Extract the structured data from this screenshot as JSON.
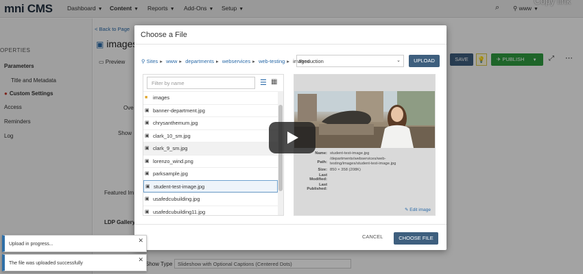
{
  "app": {
    "logo": "mni CMS",
    "copy_link": "Copy link"
  },
  "nav": {
    "items": [
      {
        "label": "Dashboard",
        "active": false
      },
      {
        "label": "Content",
        "active": true
      },
      {
        "label": "Reports",
        "active": false
      },
      {
        "label": "Add-Ons",
        "active": false
      },
      {
        "label": "Setup",
        "active": false
      }
    ],
    "site": "www"
  },
  "sidebar": {
    "heading": "OPERTIES",
    "items": [
      "Parameters",
      "Title and Metadata",
      "Custom Settings",
      "Access",
      "Reminders",
      "Log"
    ]
  },
  "page": {
    "back_link": "< Back to Page",
    "title": "images",
    "preview_tab": "Preview",
    "save": "SAVE",
    "publish": "PUBLISH",
    "labels": [
      "Ove",
      "Show",
      "Featured Im",
      "LDP Gallery",
      "Show Type"
    ],
    "select_value": "Slideshow with Optional Captions (Centered Dots)"
  },
  "modal": {
    "title": "Choose a File",
    "breadcrumb": [
      "Sites",
      "www",
      "departments",
      "webservices",
      "web-testing",
      "images"
    ],
    "environment": "Production",
    "upload": "UPLOAD",
    "filter_placeholder": "Filter by name",
    "files": [
      {
        "name": "images",
        "type": "folder"
      },
      {
        "name": "banner-department.jpg",
        "type": "file"
      },
      {
        "name": "chrysanthemum.jpg",
        "type": "file"
      },
      {
        "name": "clark_10_sm.jpg",
        "type": "file"
      },
      {
        "name": "clark_9_sm.jpg",
        "type": "file",
        "hover": true
      },
      {
        "name": "lorenzo_wind.png",
        "type": "file"
      },
      {
        "name": "parksample.jpg",
        "type": "file"
      },
      {
        "name": "student-test-image.jpg",
        "type": "file",
        "selected": true
      },
      {
        "name": "usafedcubuilding.jpg",
        "type": "file"
      },
      {
        "name": "usafedcubuilding11.jpg",
        "type": "file"
      }
    ],
    "details": {
      "name_label": "Name:",
      "name": "student-test-image.jpg",
      "path_label": "Path:",
      "path": "/departments/webservices/web-testing/images/student-test-image.jpg",
      "size_label": "Size:",
      "size": "850 × 358 (208K)",
      "modified_label": "Last Modified:",
      "modified": "",
      "published_label": "Last Published:",
      "published": ""
    },
    "edit_image": "Edit image",
    "cancel": "CANCEL",
    "choose": "CHOOSE FILE"
  },
  "toasts": [
    {
      "text": "Upload in progress..."
    },
    {
      "text": "The file was uploaded successfully"
    }
  ]
}
